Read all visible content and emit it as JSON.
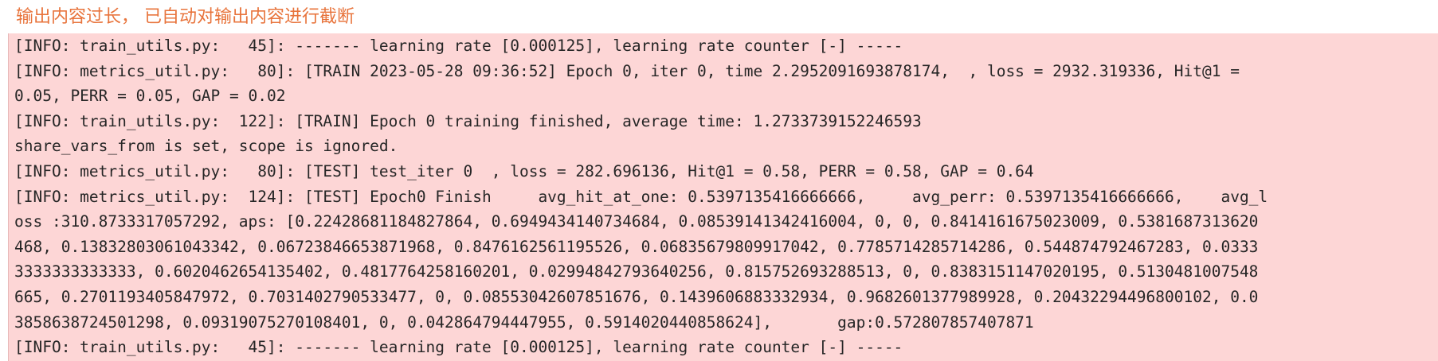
{
  "notice": {
    "text": "输出内容过长， 已自动对输出内容进行截断"
  },
  "log": {
    "lines": [
      "[INFO: train_utils.py:   45]: ------- learning rate [0.000125], learning rate counter [-] -----",
      "[INFO: metrics_util.py:   80]: [TRAIN 2023-05-28 09:36:52] Epoch 0, iter 0, time 2.2952091693878174,  , loss = 2932.319336, Hit@1 =",
      "0.05, PERR = 0.05, GAP = 0.02",
      "[INFO: train_utils.py:  122]: [TRAIN] Epoch 0 training finished, average time: 1.2733739152246593",
      "share_vars_from is set, scope is ignored.",
      "[INFO: metrics_util.py:   80]: [TEST] test_iter 0  , loss = 282.696136, Hit@1 = 0.58, PERR = 0.58, GAP = 0.64",
      "[INFO: metrics_util.py:  124]: [TEST] Epoch0 Finish     avg_hit_at_one: 0.5397135416666666,     avg_perr: 0.5397135416666666,    avg_l",
      "oss :310.8733317057292, aps: [0.22428681184827864, 0.6949434140734684, 0.08539141342416004, 0, 0, 0.8414161675023009, 0.5381687313620",
      "468, 0.13832803061043342, 0.06723846653871968, 0.8476162561195526, 0.06835679809917042, 0.7785714285714286, 0.544874792467283, 0.0333",
      "3333333333333, 0.6020462654135402, 0.4817764258160201, 0.02994842793640256, 0.815752693288513, 0, 0.8383151147020195, 0.5130481007548",
      "665, 0.2701193405847972, 0.7031402790533477, 0, 0.08553042607851676, 0.1439606883332934, 0.9682601377989928, 0.20432294496800102, 0.0",
      "3858638724501298, 0.09319075270108401, 0, 0.042864794447955, 0.5914020440858624],       gap:0.572807857407871",
      "[INFO: train_utils.py:   45]: ------- learning rate [0.000125], learning rate counter [-] -----"
    ]
  },
  "colors": {
    "notice_text": "#e8743c",
    "panel_background": "#fdd6d6",
    "log_text": "#262626"
  }
}
